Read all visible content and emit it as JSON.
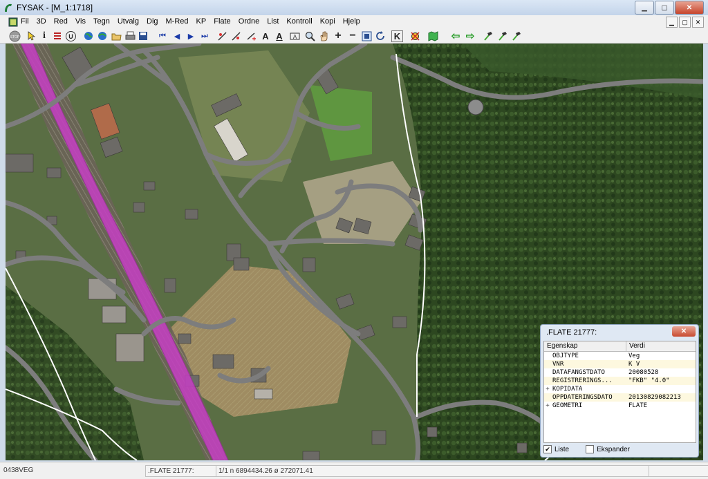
{
  "window": {
    "title": "FYSAK - [M_1:1718]"
  },
  "window_controls": {
    "minimize": "▁",
    "maximize": "▢",
    "close": "✕"
  },
  "menus": [
    "Fil",
    "3D",
    "Red",
    "Vis",
    "Tegn",
    "Utvalg",
    "Dig",
    "M-Red",
    "KP",
    "Flate",
    "Ordne",
    "List",
    "Kontroll",
    "Kopi",
    "Hjelp"
  ],
  "toolbar_icons": [
    "stop-icon",
    "pointer-icon",
    "info-icon",
    "layers-icon",
    "undo-icon",
    "globe-icon",
    "globe2-icon",
    "open-folder-icon",
    "print-icon",
    "save-icon",
    "first-icon",
    "prev-icon",
    "next-icon",
    "last-icon",
    "draw-line-icon",
    "edit-line-icon",
    "text-a-icon",
    "text-a2-icon",
    "zoom-icon",
    "pan-hand-icon",
    "zoom-in-icon",
    "zoom-out-icon",
    "zoom-window-icon",
    "refresh-icon",
    "k-icon",
    "snap-icon",
    "map-icon",
    "back-arrow-icon",
    "forward-arrow-icon",
    "hammer-icon",
    "hammer2-icon",
    "hammer3-icon"
  ],
  "toolbar_glyphs": {
    "stop": "STOP",
    "info": "i",
    "undo": "U",
    "k": "K",
    "zoom_in": "+",
    "zoom_out": "−",
    "first": "⏮",
    "prev": "◀",
    "next": "▶",
    "last": "⏭",
    "text_a": "A",
    "text_a2": "A",
    "back": "⇦",
    "forward": "⇨"
  },
  "status": {
    "layer": "0438VEG",
    "object": ".FLATE 21777:",
    "coords": "1/1  n 6894434.26  ø 272071.41"
  },
  "panel": {
    "title": ".FLATE 21777:",
    "close": "✕",
    "col_key": "Egenskap",
    "col_value": "Verdi",
    "rows": [
      {
        "expander": "",
        "key": "OBJTYPE",
        "value": "Veg"
      },
      {
        "expander": "",
        "key": "VNR",
        "value": "K V"
      },
      {
        "expander": "",
        "key": "DATAFANGSTDATO",
        "value": "20080528"
      },
      {
        "expander": "",
        "key": "REGISTRERINGS...",
        "value": "\"FKB\" \"4.0\""
      },
      {
        "expander": "+",
        "key": "KOPIDATA",
        "value": ""
      },
      {
        "expander": "",
        "key": "OPPDATERINGSDATO",
        "value": "20130829082213"
      },
      {
        "expander": "+",
        "key": "GEOMETRI",
        "value": "FLATE"
      }
    ],
    "liste_label": "Liste",
    "liste_checked": "✔",
    "ekspander_label": "Ekspander"
  },
  "colors": {
    "road": "#7d7d7d",
    "railway_highlight": "#c63fc4",
    "trail": "#ffffff",
    "forest": "#2f4a22",
    "field": "#9c8a5d"
  }
}
